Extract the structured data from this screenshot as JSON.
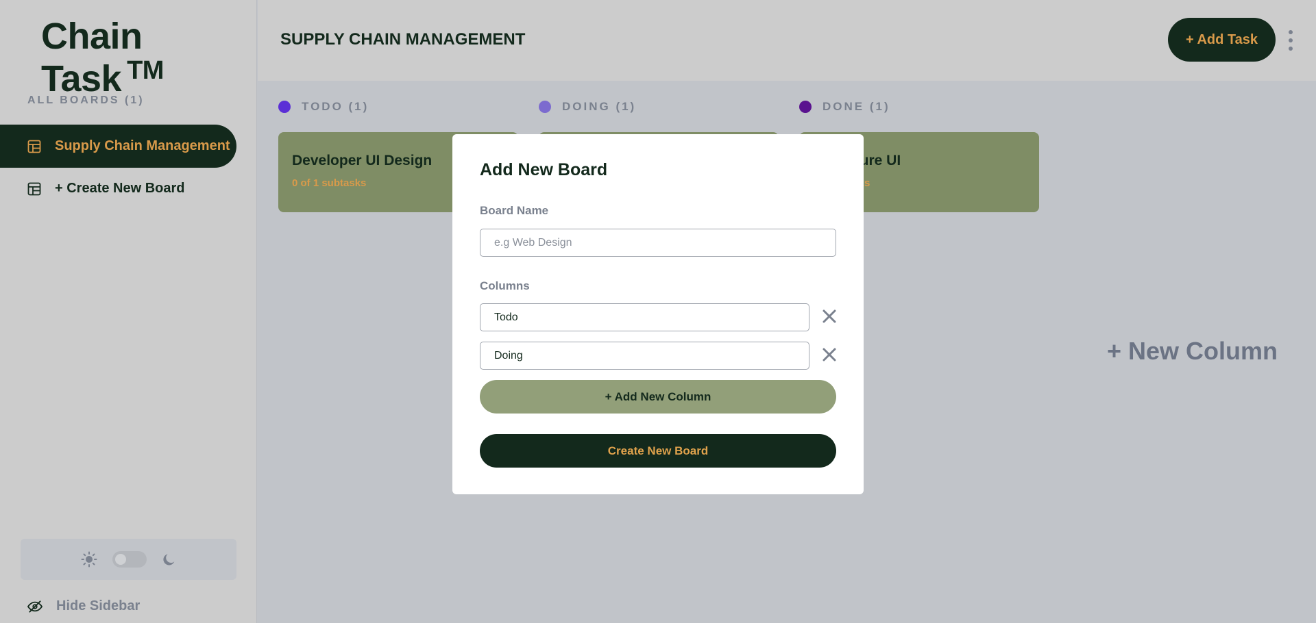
{
  "app": {
    "logo": "Chain Task",
    "trademark": "TM"
  },
  "sidebar": {
    "all_boards_label": "ALL BOARDS (1)",
    "items": [
      {
        "label": "Supply Chain Management",
        "active": true
      },
      {
        "label": "+ Create New Board",
        "active": false
      }
    ],
    "hide_label": "Hide Sidebar"
  },
  "header": {
    "title": "SUPPLY CHAIN MANAGEMENT",
    "add_task_label": "+ Add Task"
  },
  "columns": [
    {
      "label": "TODO (1)",
      "color": "#5b2fd6",
      "card": {
        "title": "Developer UI Design",
        "subtasks": "0 of 1 subtasks"
      }
    },
    {
      "label": "DOING (1)",
      "color": "#7c6bcf",
      "card": {
        "title": "",
        "subtasks": ""
      }
    },
    {
      "label": "DONE (1)",
      "color": "#5a138f",
      "card": {
        "title": "ature UI",
        "subtasks": "asks"
      }
    }
  ],
  "new_column_label": "+ New Column",
  "modal": {
    "title": "Add New Board",
    "board_name_label": "Board Name",
    "board_name_placeholder": "e.g Web Design",
    "columns_label": "Columns",
    "column_values": [
      "Todo",
      "Doing"
    ],
    "add_column_label": "+ Add New Column",
    "create_label": "Create New Board"
  },
  "colors": {
    "brand_dark": "#13291c",
    "accent": "#d99a4a",
    "card": "#7f8d65"
  },
  "icons": [
    "board-icon",
    "sun-icon",
    "moon-icon",
    "eye-slash-icon",
    "close-icon",
    "kebab-icon"
  ]
}
